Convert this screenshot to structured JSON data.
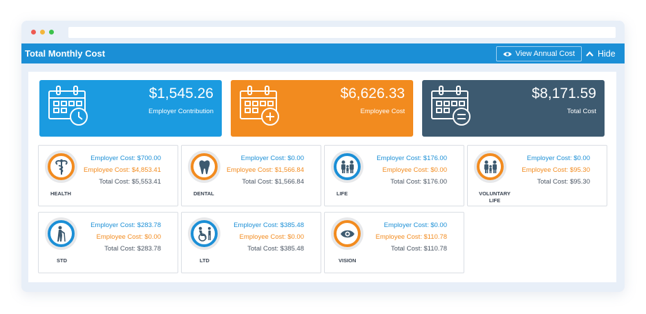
{
  "window": {
    "dots": [
      "#ee5a52",
      "#f3b63b",
      "#3cc24c"
    ]
  },
  "header": {
    "title": "Total Monthly Cost",
    "annual_button": "View Annual Cost",
    "hide_button": "Hide",
    "color": "#1b8fd6"
  },
  "summary": [
    {
      "amount": "$1,545.26",
      "label": "Employer Contribution",
      "color": "#1b9be0",
      "icon": "calendar-clock-icon"
    },
    {
      "amount": "$6,626.33",
      "label": "Employee Cost",
      "color": "#f28b1f",
      "icon": "calendar-plus-icon"
    },
    {
      "amount": "$8,171.59",
      "label": "Total Cost",
      "color": "#3d5a70",
      "icon": "calendar-equals-icon"
    }
  ],
  "benefits": [
    {
      "name": "HEALTH",
      "employer": "Employer Cost: $700.00",
      "employee": "Employee Cost: $4,853.41",
      "total": "Total Cost: $5,553.41",
      "icon": "caduceus-icon"
    },
    {
      "name": "DENTAL",
      "employer": "Employer Cost: $0.00",
      "employee": "Employee Cost: $1,566.84",
      "total": "Total Cost: $1,566.84",
      "icon": "tooth-icon"
    },
    {
      "name": "LIFE",
      "employer": "Employer Cost: $176.00",
      "employee": "Employee Cost: $0.00",
      "total": "Total Cost: $176.00",
      "icon": "family-icon"
    },
    {
      "name": "VOLUNTARY LIFE",
      "employer": "Employer Cost: $0.00",
      "employee": "Employee Cost: $95.30",
      "total": "Total Cost: $95.30",
      "icon": "family-icon"
    },
    {
      "name": "STD",
      "employer": "Employer Cost: $283.78",
      "employee": "Employee Cost: $0.00",
      "total": "Total Cost: $283.78",
      "icon": "person-cane-icon"
    },
    {
      "name": "LTD",
      "employer": "Employer Cost: $385.48",
      "employee": "Employee Cost: $0.00",
      "total": "Total Cost: $385.48",
      "icon": "wheelchair-icon"
    },
    {
      "name": "VISION",
      "employer": "Employer Cost: $0.00",
      "employee": "Employee Cost: $110.78",
      "total": "Total Cost: $110.78",
      "icon": "eye-icon"
    }
  ],
  "colors": {
    "employer": "#1b8fd6",
    "employee": "#f28b1f",
    "total": "#4a5563"
  }
}
